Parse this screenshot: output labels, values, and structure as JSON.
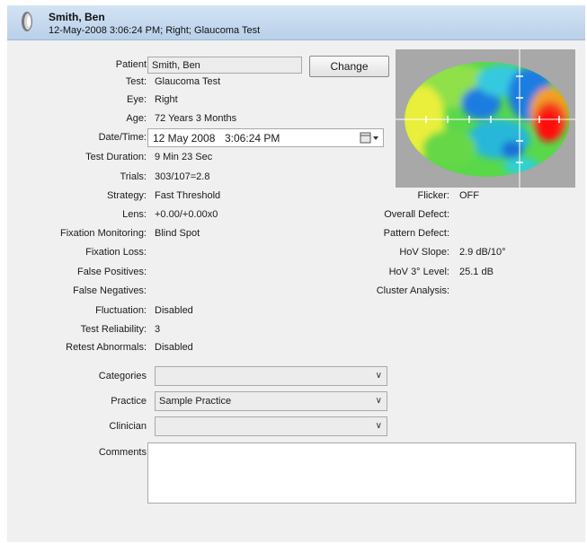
{
  "header": {
    "name": "Smith, Ben",
    "subtitle": "12-May-2008 3:06:24 PM; Right; Glaucoma Test"
  },
  "fields": {
    "patient_label": "Patient",
    "patient_value": "Smith, Ben",
    "change_button": "Change",
    "test_label": "Test:",
    "test_value": "Glaucoma Test",
    "eye_label": "Eye:",
    "eye_value": "Right",
    "age_label": "Age:",
    "age_value": "72 Years 3 Months",
    "datetime_label": "Date/Time:",
    "datetime_date": "12 May 2008",
    "datetime_time": "3:06:24 PM",
    "test_duration_label": "Test Duration:",
    "test_duration_value": "9 Min 23 Sec",
    "trials_label": "Trials:",
    "trials_value": "303/107=2.8",
    "strategy_label": "Strategy:",
    "strategy_value": "Fast Threshold",
    "lens_label": "Lens:",
    "lens_value": "+0.00/+0.00x0",
    "fixation_monitoring_label": "Fixation Monitoring:",
    "fixation_monitoring_value": "Blind Spot",
    "fixation_loss_label": "Fixation Loss:",
    "false_positives_label": "False Positives:",
    "false_negatives_label": "False Negatives:",
    "fluctuation_label": "Fluctuation:",
    "fluctuation_value": "Disabled",
    "test_reliability_label": "Test Reliability:",
    "test_reliability_value": "3",
    "retest_abnormals_label": "Retest Abnormals:",
    "retest_abnormals_value": "Disabled"
  },
  "right_fields": {
    "flicker_label": "Flicker:",
    "flicker_value": "OFF",
    "overall_defect_label": "Overall Defect:",
    "pattern_defect_label": "Pattern Defect:",
    "hov_slope_label": "HoV Slope:",
    "hov_slope_value": "2.9 dB/10°",
    "hov_level_label": "HoV 3° Level:",
    "hov_level_value": "25.1 dB",
    "cluster_analysis_label": "Cluster Analysis:"
  },
  "dropdowns": {
    "categories_label": "Categories",
    "categories_value": "",
    "practice_label": "Practice",
    "practice_value": "Sample Practice",
    "clinician_label": "Clinician",
    "clinician_value": "",
    "comments_label": "Comments"
  },
  "colors": {
    "header_bg": "#c6daf0",
    "panel_bg": "#f0f0f0",
    "map_bg": "#a8a8a8"
  }
}
